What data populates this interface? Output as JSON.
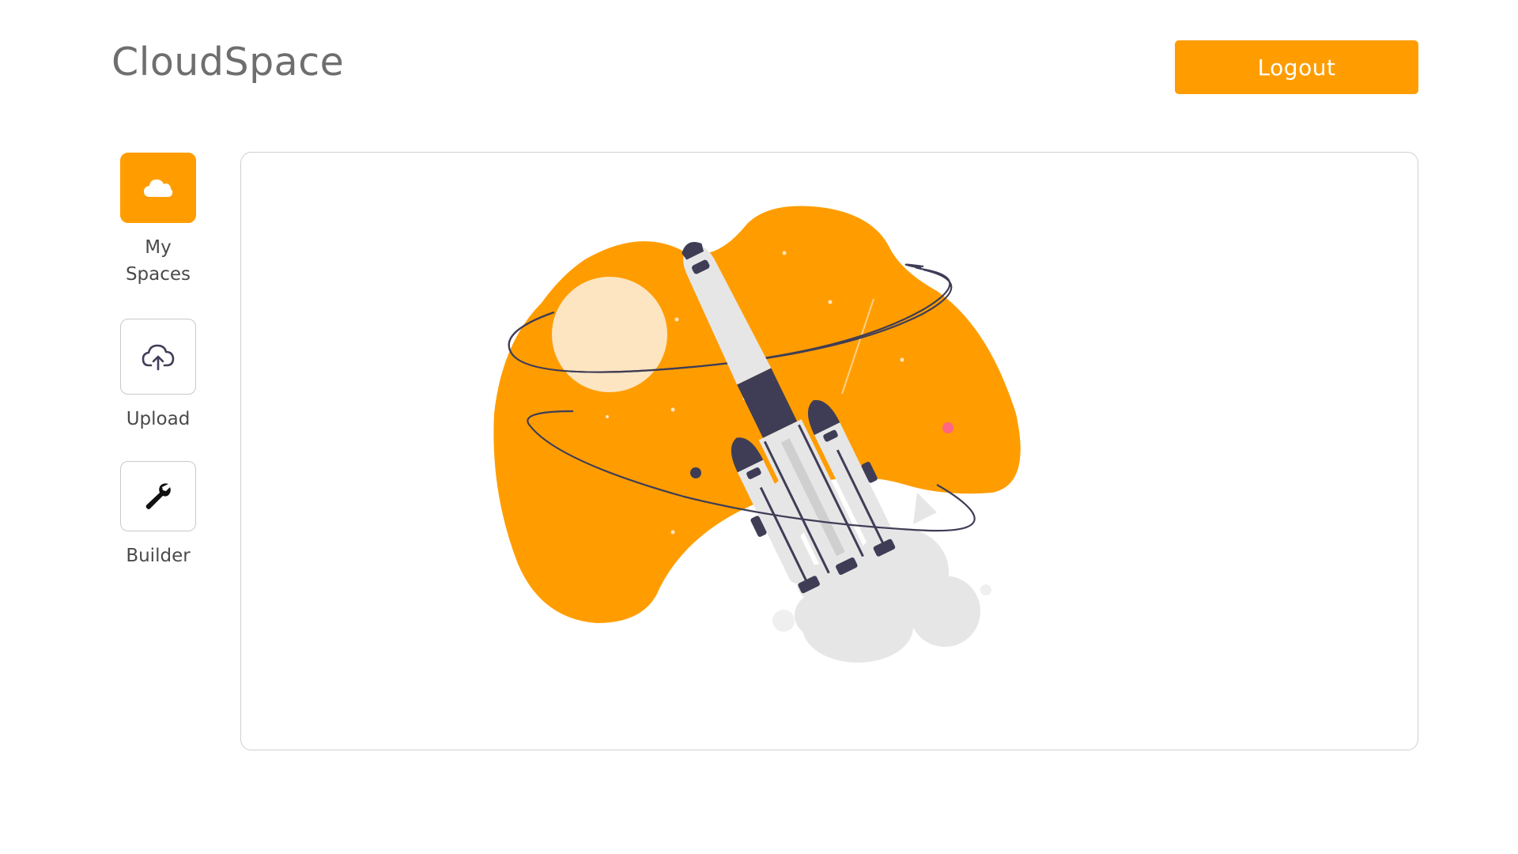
{
  "header": {
    "brand": "CloudSpace",
    "logout_label": "Logout"
  },
  "sidebar": {
    "items": [
      {
        "label": "My Spaces",
        "icon": "cloud-icon",
        "active": true
      },
      {
        "label": "Upload",
        "icon": "cloud-upload-icon",
        "active": false
      },
      {
        "label": "Builder",
        "icon": "wrench-icon",
        "active": false
      }
    ]
  },
  "main": {
    "illustration": "rocket-launch-illustration"
  },
  "colors": {
    "accent": "#ff9d00",
    "text_muted": "#6e6e6e",
    "border": "#cfcfcf",
    "rocket_dark": "#3f3d56",
    "planet": "#fde5c2",
    "smoke": "#e6e6e6",
    "star_pink": "#ff6584"
  }
}
